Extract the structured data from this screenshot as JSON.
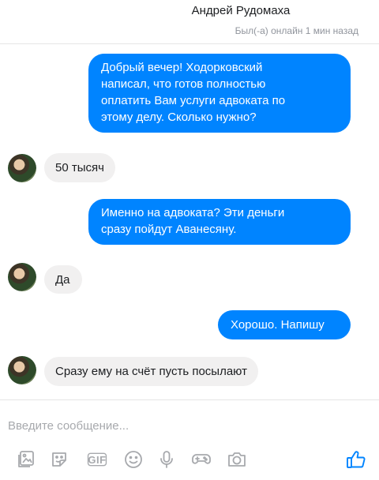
{
  "header": {
    "contact_name": "Андрей Рудомаха",
    "status": "Был(-а) онлайн 1 мин назад"
  },
  "messages": [
    {
      "direction": "out",
      "lines": [
        "Добрый вечер! Ходорковский",
        "написал, что готов полностью",
        "оплатить Вам услуги адвоката по",
        "этому делу. Сколько нужно?"
      ]
    },
    {
      "direction": "in",
      "text": "50 тысяч"
    },
    {
      "direction": "out",
      "lines": [
        "Именно на адвоката? Эти деньги",
        "сразу пойдут Аванесяну."
      ]
    },
    {
      "direction": "in",
      "text": "Да"
    },
    {
      "direction": "out",
      "text": "Хорошо. Напишу"
    },
    {
      "direction": "in",
      "text": "Сразу ему на счёт пусть посылают"
    }
  ],
  "composer": {
    "placeholder": "Введите сообщение...",
    "tools": [
      "image-icon",
      "sticker-icon",
      "gif-icon",
      "emoji-icon",
      "microphone-icon",
      "game-icon",
      "camera-icon",
      "thumbs-up-icon"
    ],
    "gif_label": "GIF"
  },
  "colors": {
    "outgoing": "#0084ff",
    "incoming": "#f1f0f0",
    "icon": "#a7a9ad",
    "like": "#0084ff"
  }
}
